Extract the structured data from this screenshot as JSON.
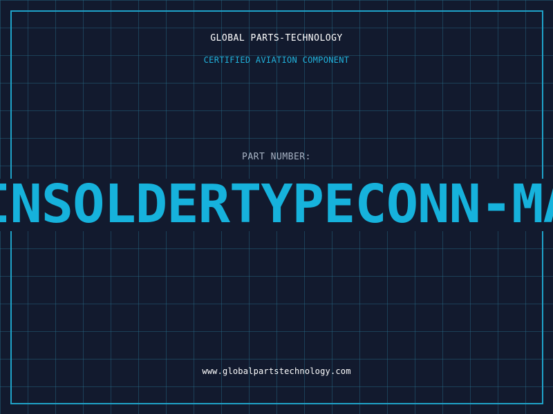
{
  "header": {
    "company": "GLOBAL PARTS-TECHNOLOGY",
    "subtitle": "CERTIFIED AVIATION COMPONENT"
  },
  "part": {
    "label": "PART NUMBER:",
    "number": "INSOLDERTYPECONN-MA"
  },
  "footer": {
    "website": "www.globalpartstechnology.com"
  },
  "colors": {
    "background": "#121a2e",
    "grid": "#286e8c",
    "accent": "#1fa3c9",
    "part_number": "#16b2dc"
  }
}
